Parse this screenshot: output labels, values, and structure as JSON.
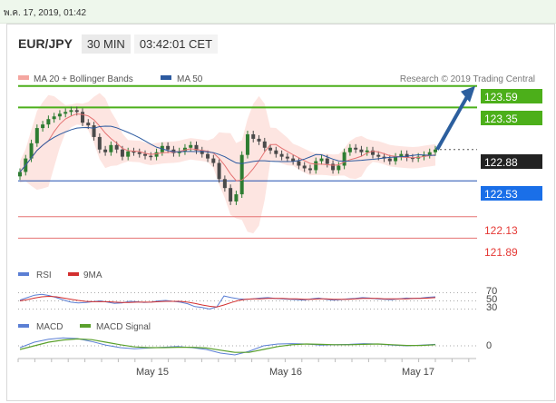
{
  "timestamp": "พ.ค. 17, 2019, 01:42",
  "header": {
    "pair": "EUR/JPY",
    "timeframe": "30 MIN",
    "time": "03:42:01 CET"
  },
  "legend": {
    "ma20_bb": "MA 20 + Bollinger Bands",
    "ma50": "MA 50",
    "research": "Research © 2019 Trading Central"
  },
  "colors": {
    "candle_up": "#2e7d32",
    "candle_down": "#4a4a4a",
    "bb_fill": "#fde0dc",
    "ma20": "#e57373",
    "ma50": "#2c5aa0",
    "resistance": "#4caf1a",
    "support_line": "#1f4fb0",
    "support_label": "#1a6fe8",
    "support_red": "#e57373",
    "arrow": "#2c5f9e",
    "rsi": "#5b7fd4",
    "rsi_ma": "#d32f2f",
    "macd": "#5b7fd4",
    "macd_signal": "#5aa02c"
  },
  "chart_data": {
    "type": "candlestick",
    "x_labels": [
      "May 15",
      "May 16",
      "May 17"
    ],
    "price_range": [
      121.6,
      123.8
    ],
    "current_price": "122.88",
    "resistance_levels": [
      "123.59",
      "123.35"
    ],
    "support_levels": [
      "122.53",
      "122.13",
      "121.89"
    ],
    "forecast": {
      "from": 122.88,
      "to": 123.59,
      "direction": "up"
    },
    "price": [
      122.63,
      122.78,
      122.95,
      123.12,
      123.16,
      123.22,
      123.25,
      123.28,
      123.3,
      123.32,
      123.3,
      123.18,
      123.15,
      123.02,
      122.88,
      122.85,
      122.93,
      122.88,
      122.8,
      122.86,
      122.85,
      122.83,
      122.81,
      122.8,
      122.85,
      122.92,
      122.88,
      122.84,
      122.86,
      122.9,
      122.93,
      122.87,
      122.83,
      122.78,
      122.73,
      122.55,
      122.45,
      122.3,
      122.38,
      122.82,
      123.05,
      123.0,
      122.97,
      122.9,
      122.87,
      122.83,
      122.8,
      122.78,
      122.75,
      122.7,
      122.67,
      122.65,
      122.75,
      122.78,
      122.72,
      122.65,
      122.7,
      122.85,
      122.9,
      122.88,
      122.85,
      122.87,
      122.82,
      122.8,
      122.78,
      122.75,
      122.8,
      122.83,
      122.79,
      122.78,
      122.8,
      122.82,
      122.85,
      122.88
    ],
    "panels": [
      {
        "name": "RSI",
        "legend": [
          "RSI",
          "9MA"
        ],
        "levels": [
          "70",
          "50",
          "30"
        ]
      },
      {
        "name": "MACD",
        "legend": [
          "MACD",
          "MACD Signal"
        ],
        "levels": [
          "0"
        ]
      }
    ],
    "rsi": [
      52,
      58,
      64,
      66,
      63,
      58,
      52,
      47,
      45,
      46,
      48,
      50,
      47,
      44,
      45,
      49,
      48,
      46,
      47,
      50,
      51,
      49,
      47,
      43,
      36,
      34,
      30,
      35,
      62,
      58,
      55,
      54,
      55,
      57,
      58,
      56,
      55,
      54,
      53,
      52,
      55,
      57,
      54,
      52,
      53,
      55,
      56,
      58,
      57,
      55,
      54,
      53,
      55,
      57,
      56,
      57,
      59,
      60
    ],
    "rsi_ma": [
      50,
      53,
      57,
      60,
      61,
      60,
      57,
      54,
      51,
      49,
      48,
      48,
      48,
      47,
      46,
      46,
      47,
      47,
      47,
      48,
      49,
      49,
      49,
      47,
      44,
      40,
      37,
      35,
      40,
      46,
      51,
      54,
      55,
      55,
      56,
      56,
      56,
      55,
      55,
      54,
      54,
      55,
      55,
      54,
      54,
      54,
      55,
      56,
      56,
      56,
      55,
      55,
      55,
      55,
      56,
      56,
      57,
      58
    ],
    "macd": [
      -0.05,
      0.1,
      0.18,
      0.22,
      0.2,
      0.12,
      0.02,
      -0.05,
      -0.08,
      -0.06,
      -0.04,
      -0.02,
      -0.05,
      -0.1,
      -0.2,
      -0.25,
      -0.15,
      0.0,
      0.05,
      0.06,
      0.05,
      0.02,
      0.03,
      0.04,
      0.06,
      0.05,
      0.02,
      0.0,
      0.02,
      0.04
    ],
    "macd_signal": [
      -0.1,
      0.0,
      0.1,
      0.16,
      0.19,
      0.17,
      0.1,
      0.03,
      -0.03,
      -0.05,
      -0.05,
      -0.04,
      -0.04,
      -0.06,
      -0.12,
      -0.18,
      -0.18,
      -0.1,
      -0.02,
      0.03,
      0.05,
      0.04,
      0.03,
      0.03,
      0.04,
      0.05,
      0.03,
      0.01,
      0.01,
      0.03
    ]
  }
}
